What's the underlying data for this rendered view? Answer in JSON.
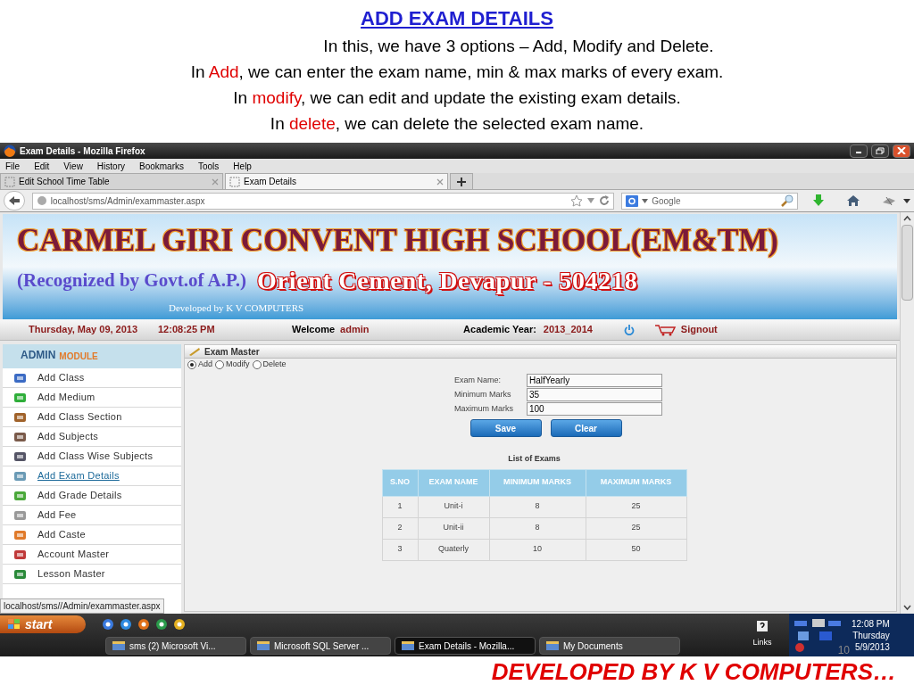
{
  "slide": {
    "title": "ADD EXAM DETAILS",
    "lines": [
      [
        {
          "text": "In this, we have 3 options – Add, Modify and Delete.",
          "kind": "plain"
        }
      ],
      [
        {
          "text": "In ",
          "kind": "plain"
        },
        {
          "text": "Add",
          "kind": "keyword"
        },
        {
          "text": ", we can enter the  exam name, min & max marks of  every exam.",
          "kind": "plain"
        }
      ],
      [
        {
          "text": "In ",
          "kind": "plain"
        },
        {
          "text": "modify",
          "kind": "keyword"
        },
        {
          "text": ", we can edit and update the existing exam details.",
          "kind": "plain"
        }
      ],
      [
        {
          "text": "In ",
          "kind": "plain"
        },
        {
          "text": "delete",
          "kind": "keyword"
        },
        {
          "text": ", we can delete the selected exam name.",
          "kind": "plain"
        }
      ]
    ],
    "footer": "DEVELOPED BY K V COMPUTERS…",
    "page_number": "10"
  },
  "browser": {
    "title": "Exam Details - Mozilla Firefox",
    "menu": [
      "File",
      "Edit",
      "View",
      "History",
      "Bookmarks",
      "Tools",
      "Help"
    ],
    "tabs": [
      {
        "label": "Edit School Time Table",
        "selected": false
      },
      {
        "label": "Exam Details",
        "selected": true
      }
    ],
    "url": "localhost/sms/Admin/exammaster.aspx",
    "search": {
      "placeholder": "Google"
    },
    "status_url": "localhost/sms//Admin/exammaster.aspx"
  },
  "page": {
    "school": "CARMEL GIRI CONVENT HIGH SCHOOL(EM&TM)",
    "recognized": "(Recognized by Govt.of  A.P.)",
    "address": "Orient Cement, Devapur - 504218",
    "developer": "Developed by K V COMPUTERS",
    "date": "Thursday, May 09, 2013",
    "time": "12:08:25 PM",
    "welcome_label": "Welcome",
    "user": "admin",
    "year_label": "Academic Year:",
    "year": "2013_2014",
    "signout": "Signout",
    "sidebar": {
      "title": "ADMIN",
      "subtitle": "MODULE",
      "items": [
        {
          "label": "Add Class",
          "selected": false
        },
        {
          "label": "Add Medium",
          "selected": false
        },
        {
          "label": "Add Class Section",
          "selected": false
        },
        {
          "label": "Add Subjects",
          "selected": false
        },
        {
          "label": "Add Class Wise Subjects",
          "selected": false
        },
        {
          "label": "Add Exam Details",
          "selected": true
        },
        {
          "label": "Add Grade Details",
          "selected": false
        },
        {
          "label": "Add Fee",
          "selected": false
        },
        {
          "label": "Add Caste",
          "selected": false
        },
        {
          "label": "Account Master",
          "selected": false
        },
        {
          "label": "Lesson Master",
          "selected": false
        }
      ]
    },
    "panel": {
      "title": "Exam Master",
      "options": [
        {
          "label": "Add",
          "selected": true
        },
        {
          "label": "Modify",
          "selected": false
        },
        {
          "label": "Delete",
          "selected": false
        }
      ],
      "fields": [
        {
          "label": "Exam Name:",
          "value": "HalfYearly"
        },
        {
          "label": "Minimum Marks",
          "value": "35"
        },
        {
          "label": "Maximum Marks",
          "value": "100"
        }
      ],
      "buttons": [
        "Save",
        "Clear"
      ],
      "table": {
        "title": "List of Exams",
        "columns": [
          "S.NO",
          "EXAM NAME",
          "MINIMUM MARKS",
          "MAXIMUM MARKS"
        ],
        "rows": [
          [
            "1",
            "Unit-i",
            "8",
            "25"
          ],
          [
            "2",
            "Unit-ii",
            "8",
            "25"
          ],
          [
            "3",
            "Quaterly",
            "10",
            "50"
          ]
        ]
      }
    }
  },
  "taskbar": {
    "start": "start",
    "tasks": [
      {
        "label": "sms (2)   Microsoft Vi...",
        "selected": false
      },
      {
        "label": "Microsoft SQL Server ...",
        "selected": false
      },
      {
        "label": "Exam Details - Mozilla...",
        "selected": true
      },
      {
        "label": "My Documents",
        "selected": false
      }
    ],
    "links": "Links",
    "clock": {
      "time": "12:08 PM",
      "day": "Thursday",
      "date": "5/9/2013"
    }
  }
}
